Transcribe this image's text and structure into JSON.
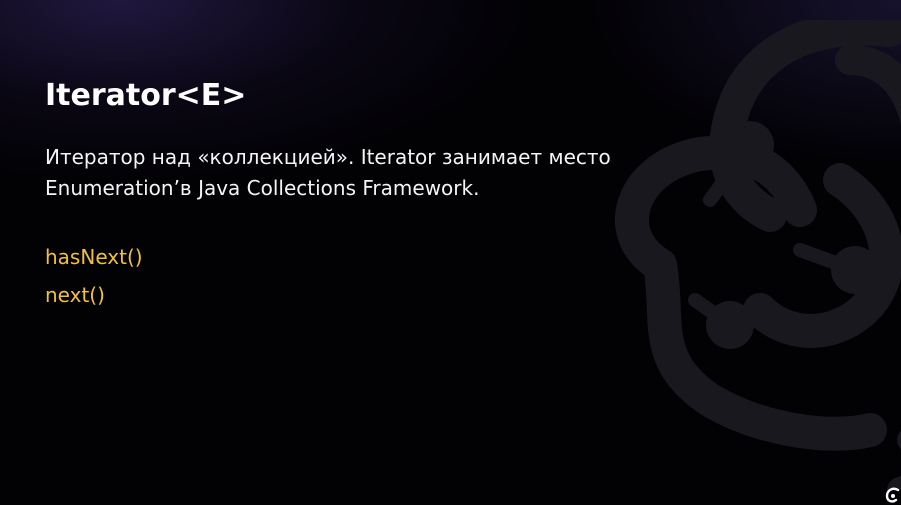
{
  "slide": {
    "title": "Iterator<E>",
    "description": "Итератор над «коллекцией». Iterator занимает место Enumeration’в Java Collections Framework.",
    "methods": [
      "hasNext()",
      "next()"
    ]
  },
  "colors": {
    "background": "#020104",
    "title": "#ffffff",
    "text": "#f4f4f6",
    "accent": "#f2c13c",
    "watermark": "#1a181f"
  },
  "icons": {
    "watermark": "brand-logo-watermark-icon",
    "corner": "brand-logo-corner-icon"
  }
}
